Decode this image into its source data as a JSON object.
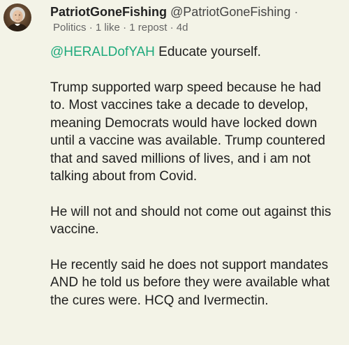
{
  "author": {
    "display_name": "PatriotGoneFishing",
    "handle": "@PatriotGoneFishing",
    "avatar_icon": "portrait-avatar"
  },
  "meta": {
    "separator": "·",
    "category": "Politics",
    "likes": "1 like",
    "reposts": "1 repost",
    "age": "4d"
  },
  "post": {
    "mention": "@HERALDofYAH",
    "first_line_text": " Educate yourself.",
    "paragraphs": [
      "Trump supported warp speed because he had to. Most vaccines take a decade to develop, meaning Democrats would have locked down until a vaccine was available. Trump countered that and saved millions of lives, and i am not talking about from Covid.",
      "He will not and should not come out against this vaccine.",
      "He recently said he does not support mandates AND he told us before they were available what the cures were. HCQ and Ivermectin."
    ]
  },
  "colors": {
    "background": "#f3f3e7",
    "mention": "#1ea97c",
    "meta_text": "#666666"
  }
}
